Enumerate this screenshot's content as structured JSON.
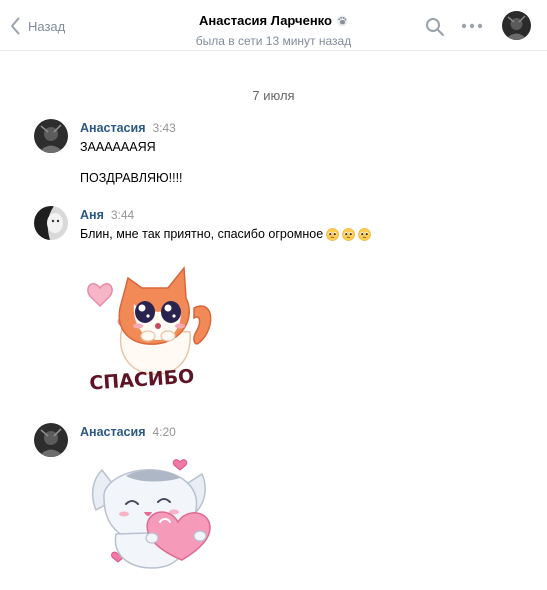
{
  "header": {
    "back_label": "Назад",
    "title": "Анастасия Ларченко",
    "subtitle": "была в сети 13 минут назад"
  },
  "date_separator": "7 июля",
  "messages": [
    {
      "author": "Анастасия",
      "time": "3:43",
      "lines": [
        "ЗААААААЯЯ",
        "ПОЗДРАВЛЯЮ!!!!"
      ]
    },
    {
      "author": "Аня",
      "time": "3:44",
      "text": "Блин, мне так приятно, спасибо огромное",
      "emoji": [
        "pleading-face",
        "pleading-face",
        "pleading-face"
      ],
      "sticker_caption": "СПАСИБО"
    },
    {
      "author": "Анастасия",
      "time": "4:20",
      "sticker": "white-cat-with-heart"
    }
  ],
  "icons": [
    "back-chevron-icon",
    "search-icon",
    "more-icon",
    "paw-icon"
  ],
  "colors": {
    "accent_name": "#2a5885",
    "muted": "#818c99",
    "divider": "#e7e8ec"
  }
}
